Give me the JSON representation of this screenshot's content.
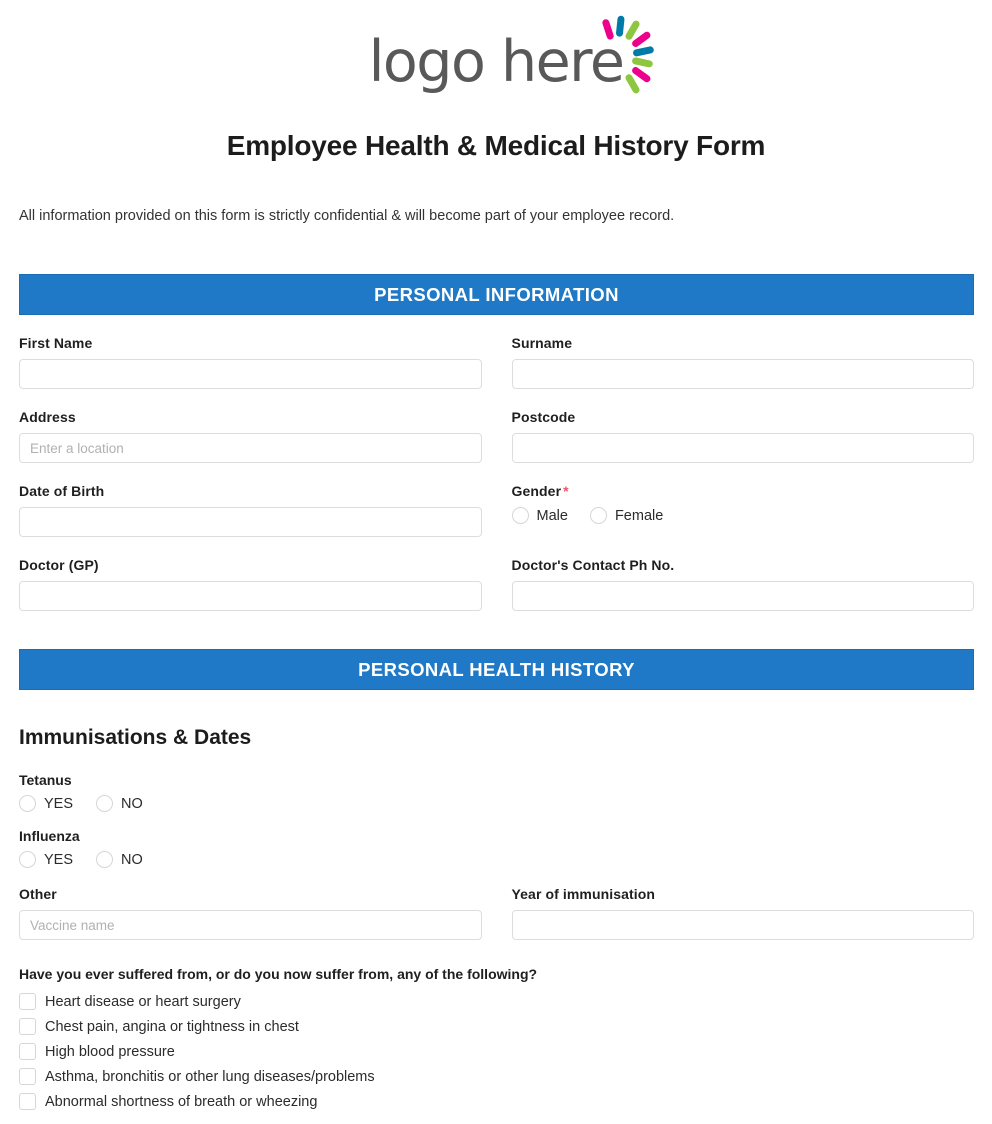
{
  "logo": {
    "text": "logo here",
    "burst_colors": [
      "#ec008c",
      "#007ba7",
      "#8dc63f"
    ]
  },
  "header": {
    "title": "Employee Health & Medical History Form",
    "intro": "All information provided on this form is strictly confidential & will become part of your employee record."
  },
  "sections": {
    "personal_information": {
      "bar_label": "PERSONAL INFORMATION",
      "bar_color": "#1f79c7",
      "fields": {
        "first_name": {
          "label": "First Name",
          "value": "",
          "placeholder": ""
        },
        "surname": {
          "label": "Surname",
          "value": "",
          "placeholder": ""
        },
        "address": {
          "label": "Address",
          "value": "",
          "placeholder": "Enter a location"
        },
        "postcode": {
          "label": "Postcode",
          "value": "",
          "placeholder": ""
        },
        "date_of_birth": {
          "label": "Date of Birth",
          "value": "",
          "placeholder": ""
        },
        "gender": {
          "label": "Gender",
          "required_marker": "*",
          "options": [
            "Male",
            "Female"
          ],
          "selected": ""
        },
        "doctor_gp": {
          "label": "Doctor (GP)",
          "value": "",
          "placeholder": ""
        },
        "doctor_phone": {
          "label": "Doctor's Contact Ph No.",
          "value": "",
          "placeholder": ""
        }
      }
    },
    "personal_health_history": {
      "bar_label": "PERSONAL HEALTH HISTORY",
      "bar_color": "#1f79c7",
      "subheading": "Immunisations & Dates",
      "immunisations": [
        {
          "label": "Tetanus",
          "options": [
            "YES",
            "NO"
          ],
          "selected": ""
        },
        {
          "label": "Influenza",
          "options": [
            "YES",
            "NO"
          ],
          "selected": ""
        }
      ],
      "other_vaccine": {
        "label": "Other",
        "value": "",
        "placeholder": "Vaccine name"
      },
      "year_of_immunisation": {
        "label": "Year of immunisation",
        "value": "",
        "placeholder": ""
      },
      "conditions_question": "Have you ever suffered from, or do you now suffer from, any of the following?",
      "conditions": [
        "Heart disease or heart surgery",
        "Chest pain, angina or tightness in chest",
        "High blood pressure",
        "Asthma, bronchitis or other lung diseases/problems",
        "Abnormal shortness of breath or wheezing"
      ]
    }
  }
}
